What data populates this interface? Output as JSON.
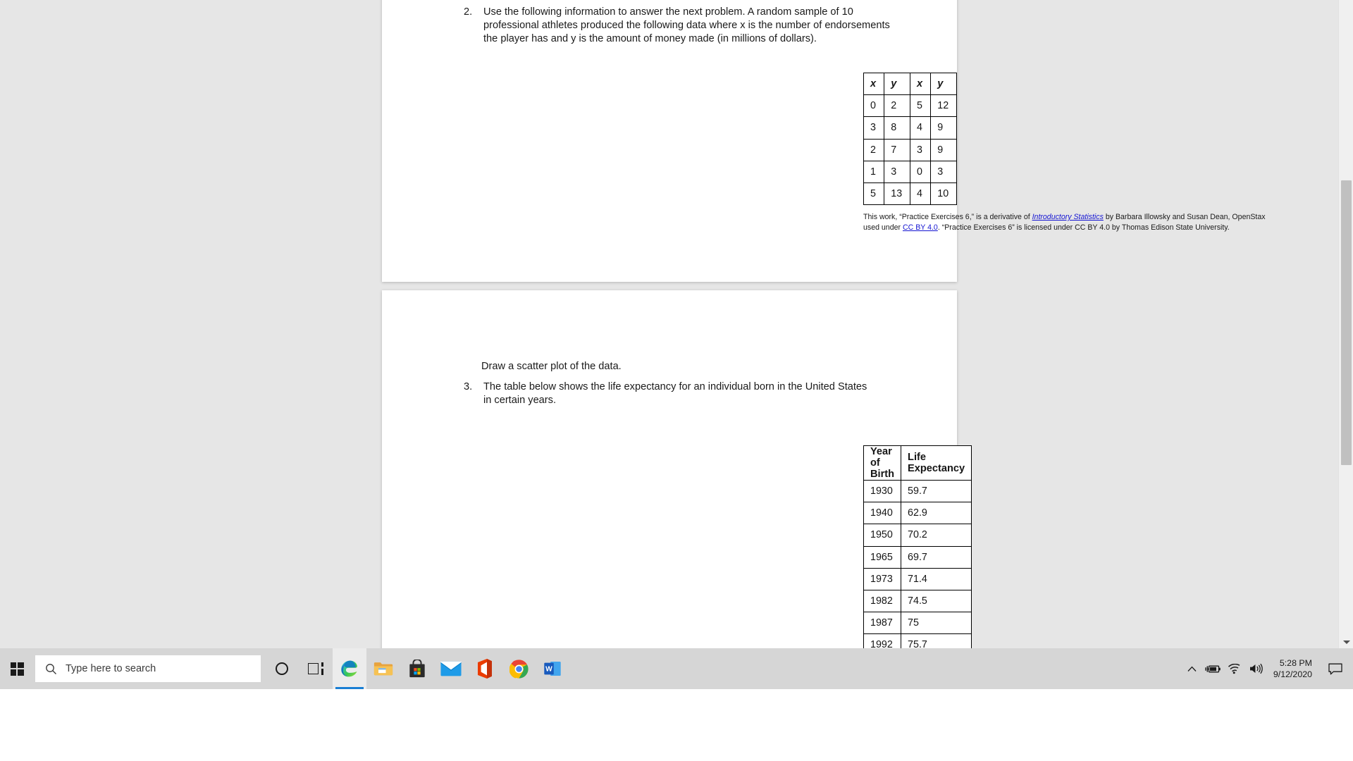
{
  "viewer": {
    "background_color": "#e6e6e6",
    "scrollbar": {
      "name": "vertical-scrollbar",
      "thumb_top_pct": 28,
      "thumb_height_pct": 44
    }
  },
  "document": {
    "page1": {
      "question": {
        "number": "2.",
        "text": "Use the following information to answer the next problem. A random sample of 10 professional athletes produced the following data where x is the number of endorsements the player has and y is the amount of money made (in millions of dollars)."
      },
      "table": {
        "headers": [
          "x",
          "y",
          "x",
          "y"
        ],
        "rows": [
          [
            "0",
            "2",
            "5",
            "12"
          ],
          [
            "3",
            "8",
            "4",
            "9"
          ],
          [
            "2",
            "7",
            "3",
            "9"
          ],
          [
            "1",
            "3",
            "0",
            "3"
          ],
          [
            "5",
            "13",
            "4",
            "10"
          ]
        ]
      },
      "attribution": {
        "part1": "This work, “Practice Exercises 6,” is a derivative of ",
        "link1": "Introductory Statistics",
        "part2": " by Barbara Illowsky and Susan Dean, OpenStax used under ",
        "link2": "CC BY 4.0",
        "part3": ". “Practice Exercises 6” is licensed under CC BY 4.0 by Thomas Edison State University."
      }
    },
    "page2": {
      "instruction": "Draw a scatter plot of the data.",
      "question": {
        "number": "3.",
        "text": "The table below shows the life expectancy for an individual born in the United States in certain years."
      },
      "table": {
        "headers": [
          "Year of Birth",
          "Life Expectancy"
        ],
        "rows": [
          [
            "1930",
            "59.7"
          ],
          [
            "1940",
            "62.9"
          ],
          [
            "1950",
            "70.2"
          ],
          [
            "1965",
            "69.7"
          ],
          [
            "1973",
            "71.4"
          ],
          [
            "1982",
            "74.5"
          ],
          [
            "1987",
            "75"
          ],
          [
            "1992",
            "75.7"
          ]
        ]
      }
    }
  },
  "taskbar": {
    "start_label": "Start",
    "search": {
      "placeholder": "Type here to search"
    },
    "items": [
      {
        "name": "cortana-icon",
        "label": "Cortana"
      },
      {
        "name": "task-view-icon",
        "label": "Task View"
      },
      {
        "name": "microsoft-edge-icon",
        "label": "Microsoft Edge",
        "active": true
      },
      {
        "name": "file-explorer-icon",
        "label": "File Explorer"
      },
      {
        "name": "microsoft-store-icon",
        "label": "Microsoft Store"
      },
      {
        "name": "mail-icon",
        "label": "Mail"
      },
      {
        "name": "microsoft-office-icon",
        "label": "Office"
      },
      {
        "name": "google-chrome-icon",
        "label": "Google Chrome"
      },
      {
        "name": "microsoft-word-icon",
        "label": "Microsoft Word"
      }
    ],
    "tray": {
      "show_hidden_label": "Show hidden icons",
      "battery_label": "Battery charging",
      "network_label": "Network",
      "volume_label": "Volume",
      "time": "5:28 PM",
      "date": "9/12/2020",
      "notifications_label": "Notifications"
    }
  }
}
